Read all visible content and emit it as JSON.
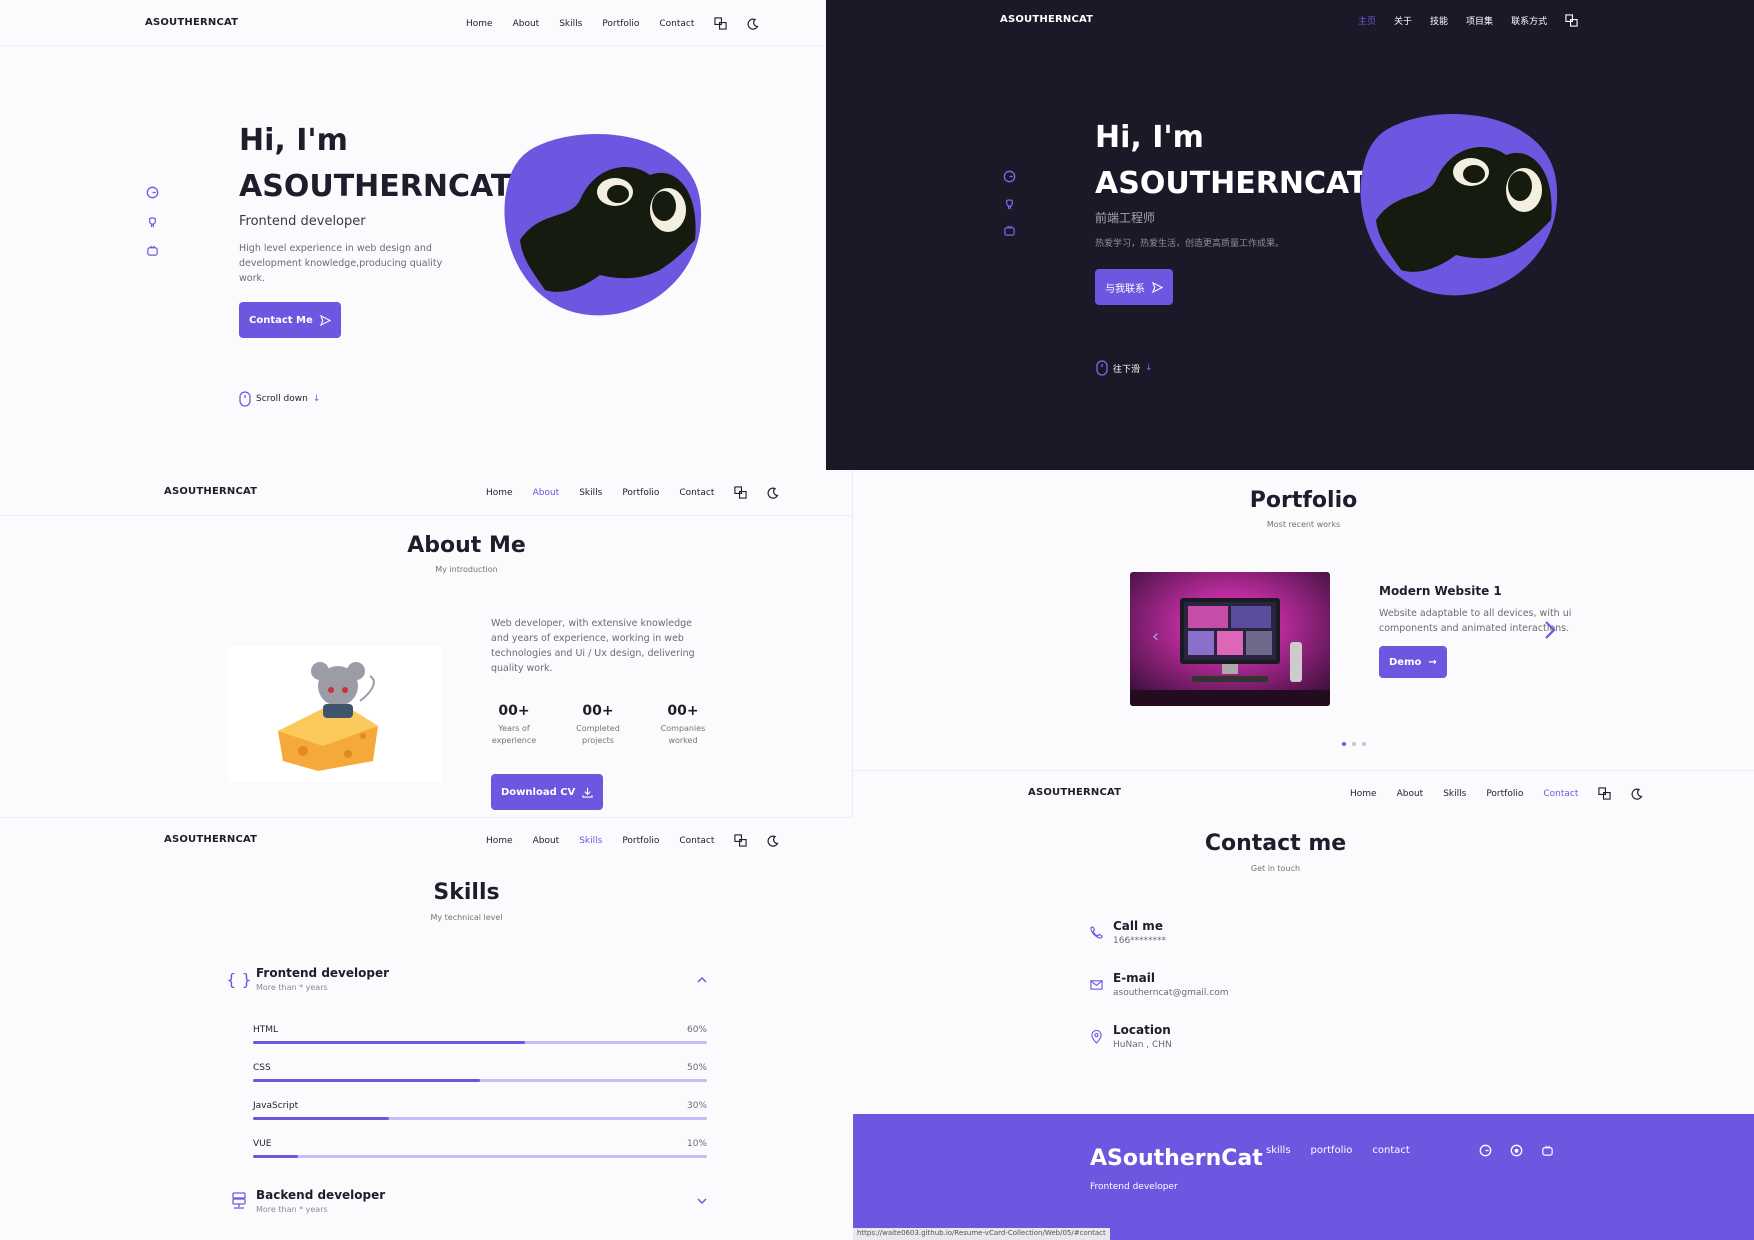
{
  "brand": "ASOUTHERNCAT",
  "nav_en": [
    "Home",
    "About",
    "Skills",
    "Portfolio",
    "Contact"
  ],
  "nav_cn": [
    "主页",
    "关于",
    "技能",
    "项目集",
    "联系方式"
  ],
  "hero_en": {
    "greeting": "Hi, I'm",
    "name": "ASOUTHERNCAT",
    "role": "Frontend developer",
    "desc": "High level experience in web design and development knowledge,producing quality work.",
    "button": "Contact Me",
    "scroll": "Scroll down"
  },
  "hero_cn": {
    "greeting": "Hi, I'm",
    "name": "ASOUTHERNCAT",
    "role": "前端工程师",
    "desc": "热爱学习，热爱生活，创造更高质量工作成果。",
    "button": "与我联系",
    "scroll": "往下滑"
  },
  "about": {
    "title": "About Me",
    "subtitle": "My introduction",
    "desc": "Web developer, with extensive knowledge and years of experience, working in web technologies and Ui / Ux design, delivering quality work.",
    "stats": [
      {
        "num": "00+",
        "label1": "Years of",
        "label2": "experience"
      },
      {
        "num": "00+",
        "label1": "Completed",
        "label2": "projects"
      },
      {
        "num": "00+",
        "label1": "Companies",
        "label2": "worked"
      }
    ],
    "button": "Download CV"
  },
  "portfolio": {
    "title": "Portfolio",
    "subtitle": "Most recent works",
    "item_title": "Modern Website 1",
    "item_desc": "Website adaptable to all devices, with ui components and animated interactions.",
    "button": "Demo"
  },
  "skills": {
    "title": "Skills",
    "subtitle": "My technical level",
    "frontend": {
      "title": "Frontend developer",
      "sub": "More than * years"
    },
    "items": [
      {
        "name": "HTML",
        "pct": "60%",
        "value": 60
      },
      {
        "name": "CSS",
        "pct": "50%",
        "value": 50
      },
      {
        "name": "JavaScript",
        "pct": "30%",
        "value": 30
      },
      {
        "name": "VUE",
        "pct": "10%",
        "value": 10
      }
    ],
    "backend": {
      "title": "Backend developer",
      "sub": "More than * years"
    }
  },
  "contact": {
    "title": "Contact me",
    "subtitle": "Get in touch",
    "items": [
      {
        "title": "Call me",
        "value": "166********"
      },
      {
        "title": "E-mail",
        "value": "asoutherncat@gmail.com"
      },
      {
        "title": "Location",
        "value": "HuNan , CHN"
      }
    ]
  },
  "footer": {
    "title": "ASouthernCat",
    "sub": "Frontend developer",
    "links": [
      "skills",
      "portfolio",
      "contact"
    ]
  },
  "status_url": "https://waite0603.github.io/Resume-vCard-Collection/Web/05/#contact",
  "colors": {
    "accent": "#6e57e0",
    "dark_bg": "#1b1827",
    "light_bg": "#fbfbfe"
  }
}
